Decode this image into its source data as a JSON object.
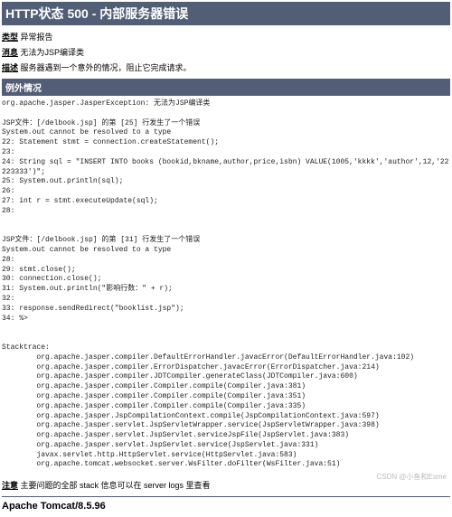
{
  "title": "HTTP状态 500 - 内部服务器错误",
  "labels": {
    "type": "类型",
    "message": "消息",
    "description": "描述",
    "exception": "例外情况",
    "note": "注意"
  },
  "type_value": "异常报告",
  "message_value": "无法为JSP编译类",
  "description_value": "服务器遇到一个意外的情况，阻止它完成请求。",
  "exception_block": "org.apache.jasper.JasperException: 无法为JSP编译类\n\nJSP文件：[/delbook.jsp] 的第 [25] 行发生了一个错误\nSystem.out cannot be resolved to a type\n22: Statement stmt = connection.createStatement();\n23:\n24: String sql = \"INSERT INTO books (bookid,bkname,author,price,isbn) VALUE(1005,'kkkk','author',12,'22223333')\";\n25: System.out.println(sql);\n26:\n27: int r = stmt.executeUpdate(sql);\n28:\n\n\nJSP文件：[/delbook.jsp] 的第 [31] 行发生了一个错误\nSystem.out cannot be resolved to a type\n28:\n29: stmt.close();\n30: connection.close();\n31: System.out.println(\"影响行数：\" + r);\n32:\n33: response.sendRedirect(\"booklist.jsp\");\n34: %>\n\n\nStacktrace:\n        org.apache.jasper.compiler.DefaultErrorHandler.javacError(DefaultErrorHandler.java:102)\n        org.apache.jasper.compiler.ErrorDispatcher.javacError(ErrorDispatcher.java:214)\n        org.apache.jasper.compiler.JDTCompiler.generateClass(JDTCompiler.java:600)\n        org.apache.jasper.compiler.Compiler.compile(Compiler.java:381)\n        org.apache.jasper.compiler.Compiler.compile(Compiler.java:351)\n        org.apache.jasper.compiler.Compiler.compile(Compiler.java:335)\n        org.apache.jasper.JspCompilationContext.compile(JspCompilationContext.java:597)\n        org.apache.jasper.servlet.JspServletWrapper.service(JspServletWrapper.java:398)\n        org.apache.jasper.servlet.JspServlet.serviceJspFile(JspServlet.java:383)\n        org.apache.jasper.servlet.JspServlet.service(JspServlet.java:331)\n        javax.servlet.http.HttpServlet.service(HttpServlet.java:583)\n        org.apache.tomcat.websocket.server.WsFilter.doFilter(WsFilter.java:51)",
  "note_value": "主要问题的全部 stack 信息可以在 server logs 里查看",
  "footer": "Apache Tomcat/8.5.96",
  "watermark": "CSDN @小鱼和Esme"
}
